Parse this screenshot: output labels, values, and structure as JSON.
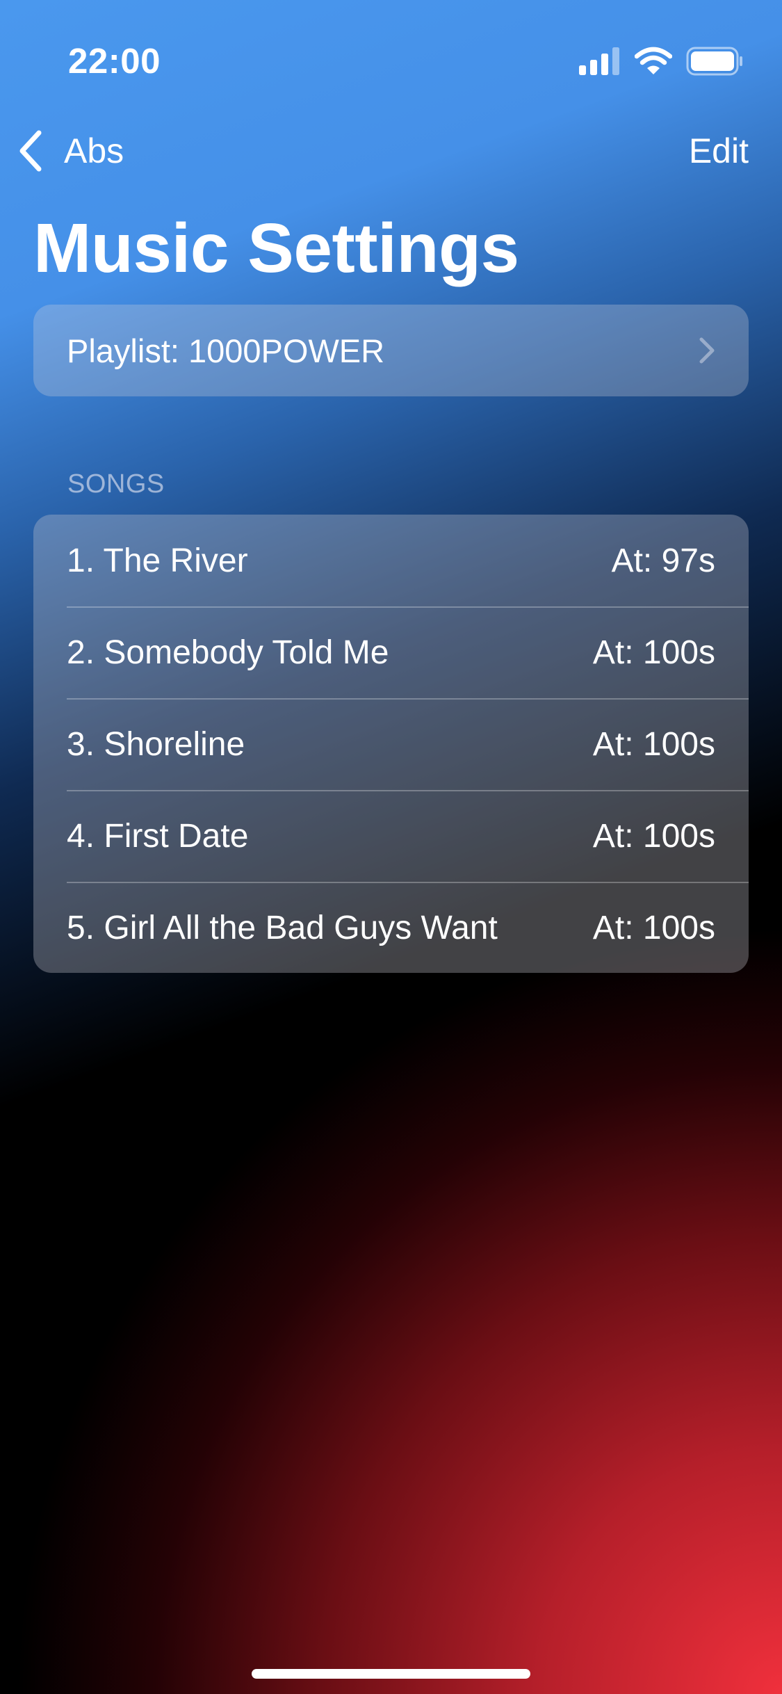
{
  "status_bar": {
    "time": "22:00",
    "icons": [
      "cellular-signal-icon",
      "wifi-icon",
      "battery-icon"
    ]
  },
  "nav": {
    "back_label": "Abs",
    "back_icon": "chevron-left-icon",
    "edit_label": "Edit"
  },
  "page": {
    "title": "Music Settings"
  },
  "playlist": {
    "label": "Playlist: 1000POWER",
    "icon": "chevron-right-icon"
  },
  "songs": {
    "header": "SONGS",
    "items": [
      {
        "title": "1. The River",
        "time": "At: 97s"
      },
      {
        "title": "2. Somebody Told Me",
        "time": "At: 100s"
      },
      {
        "title": "3. Shoreline",
        "time": "At: 100s"
      },
      {
        "title": "4. First Date",
        "time": "At: 100s"
      },
      {
        "title": "5. Girl All the Bad Guys Want",
        "time": "At: 100s"
      }
    ]
  },
  "colors": {
    "background_top": "#4a98ee",
    "background_bottom": "#f0303c",
    "text": "#ffffff"
  }
}
